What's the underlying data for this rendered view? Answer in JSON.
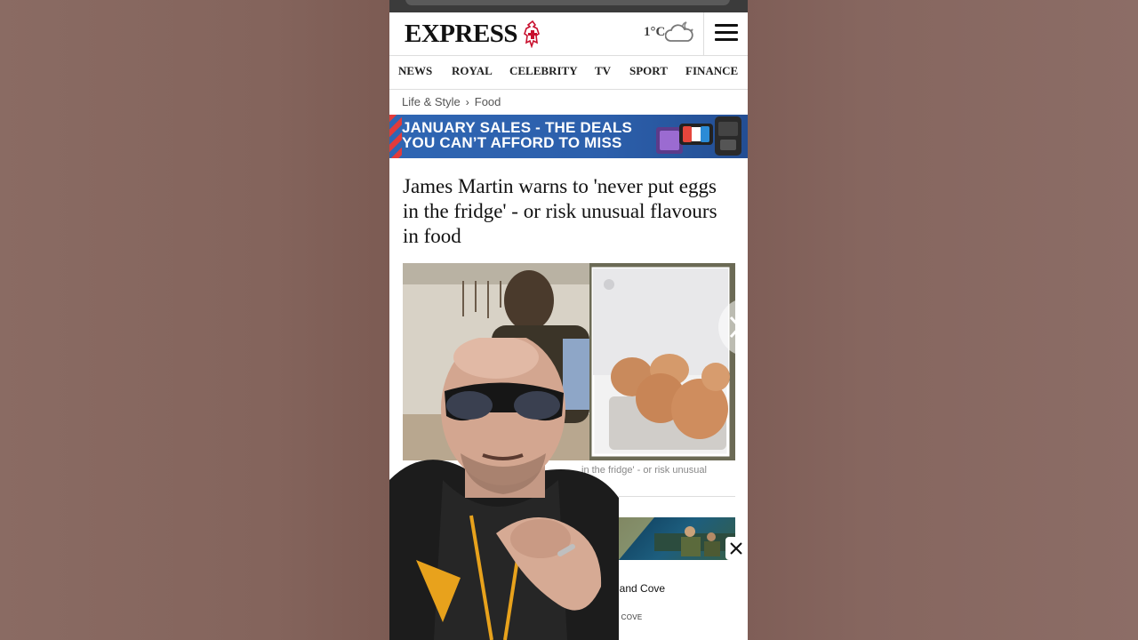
{
  "header": {
    "logo": "EXPRESS",
    "temperature": "1°C",
    "weather_icon": "cloud-moon-icon",
    "menu_icon": "hamburger-menu-icon"
  },
  "nav": {
    "items": [
      "NEWS",
      "ROYAL",
      "CELEBRITY",
      "TV",
      "SPORT",
      "FINANCE"
    ]
  },
  "breadcrumb": {
    "parent": "Life & Style",
    "current": "Food"
  },
  "banner": {
    "line1": "JANUARY SALES - THE DEALS",
    "line2": "YOU CAN’T AFFORD TO MISS"
  },
  "article": {
    "headline": "James Martin warns to 'never put eggs in the fridge' - or risk unusual flavours in food",
    "caption": "in the fridge' - or risk unusual"
  },
  "ad": {
    "title": "lf, and Cove",
    "subtitle": "ND COVE"
  },
  "colors": {
    "banner_blue": "#2f66b3",
    "headline_text": "#111111",
    "background": "#8a6b63"
  }
}
